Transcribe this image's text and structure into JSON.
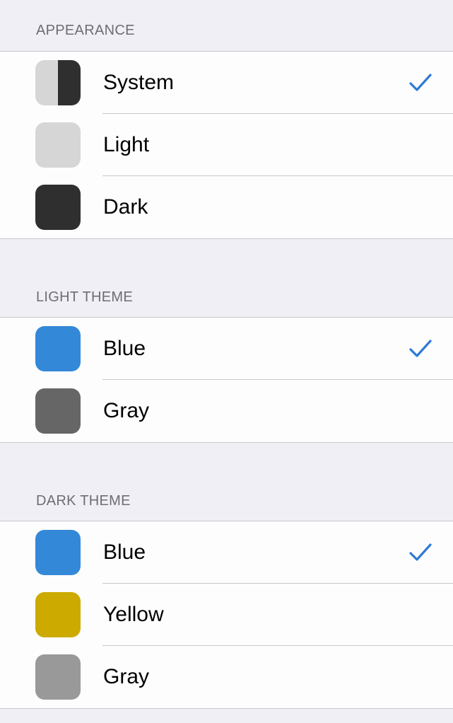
{
  "sections": [
    {
      "header": "APPEARANCE",
      "items": [
        {
          "label": "System",
          "swatch": "split-light-dark",
          "selected": true
        },
        {
          "label": "Light",
          "swatch": "#d6d6d6",
          "selected": false
        },
        {
          "label": "Dark",
          "swatch": "#2f2f2f",
          "selected": false
        }
      ]
    },
    {
      "header": "LIGHT THEME",
      "items": [
        {
          "label": "Blue",
          "swatch": "#3388d8",
          "selected": true
        },
        {
          "label": "Gray",
          "swatch": "#666666",
          "selected": false
        }
      ]
    },
    {
      "header": "DARK THEME",
      "items": [
        {
          "label": "Blue",
          "swatch": "#3388d8",
          "selected": true
        },
        {
          "label": "Yellow",
          "swatch": "#ccaa00",
          "selected": false
        },
        {
          "label": "Gray",
          "swatch": "#999999",
          "selected": false
        }
      ]
    }
  ],
  "colors": {
    "background": "#f0eff5",
    "cell": "#fdfdfd",
    "separator": "#c8c7cc",
    "header_text": "#6d6d72",
    "checkmark": "#2f7ad6",
    "split_light": "#d6d6d6",
    "split_dark": "#2f2f2f"
  },
  "icons": {
    "selected": "checkmark-icon"
  }
}
